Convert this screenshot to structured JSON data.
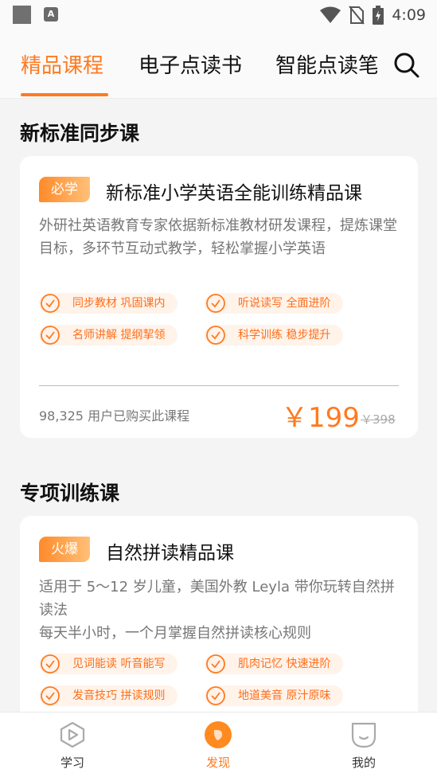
{
  "status_bar": {
    "time": "4:09",
    "keyboard_icon_text": "A"
  },
  "tabs": [
    {
      "label": "精品课程",
      "active": true
    },
    {
      "label": "电子点读书",
      "active": false
    },
    {
      "label": "智能点读笔",
      "active": false
    }
  ],
  "sections": [
    {
      "title": "新标准同步课",
      "card": {
        "badge": "必学",
        "title": "新标准小学英语全能训练精品课",
        "description": "外研社英语教育专家依据新标准教材研发课程，提炼课堂目标，多环节互动式教学，轻松掌握小学英语",
        "features": [
          "同步教材 巩固课内",
          "听说读写 全面进阶",
          "名师讲解 提纲挈领",
          "科学训练 稳步提升"
        ],
        "buyers": "98,325 用户已购买此课程",
        "price": "￥199",
        "original_price": "￥398"
      }
    },
    {
      "title": "专项训练课",
      "card": {
        "badge": "火爆",
        "title": "自然拼读精品课",
        "description_line1": "适用于 5～12 岁儿童，美国外教 Leyla 带你玩转自然拼读法",
        "description_line2": "每天半小时，一个月掌握自然拼读核心规则",
        "features": [
          "见词能读 听音能写",
          "肌肉记忆 快速进阶",
          "发音技巧 拼读规则",
          "地道美音 原汁原味"
        ]
      }
    }
  ],
  "bottom_nav": [
    {
      "label": "学习",
      "icon": "play-icon",
      "active": false
    },
    {
      "label": "发现",
      "icon": "discover-icon",
      "active": true
    },
    {
      "label": "我的",
      "icon": "profile-icon",
      "active": false
    }
  ],
  "colors": {
    "accent": "#ff7a1f",
    "feature_bg": "#fff3ea",
    "page_bg": "#f4f4f4"
  }
}
